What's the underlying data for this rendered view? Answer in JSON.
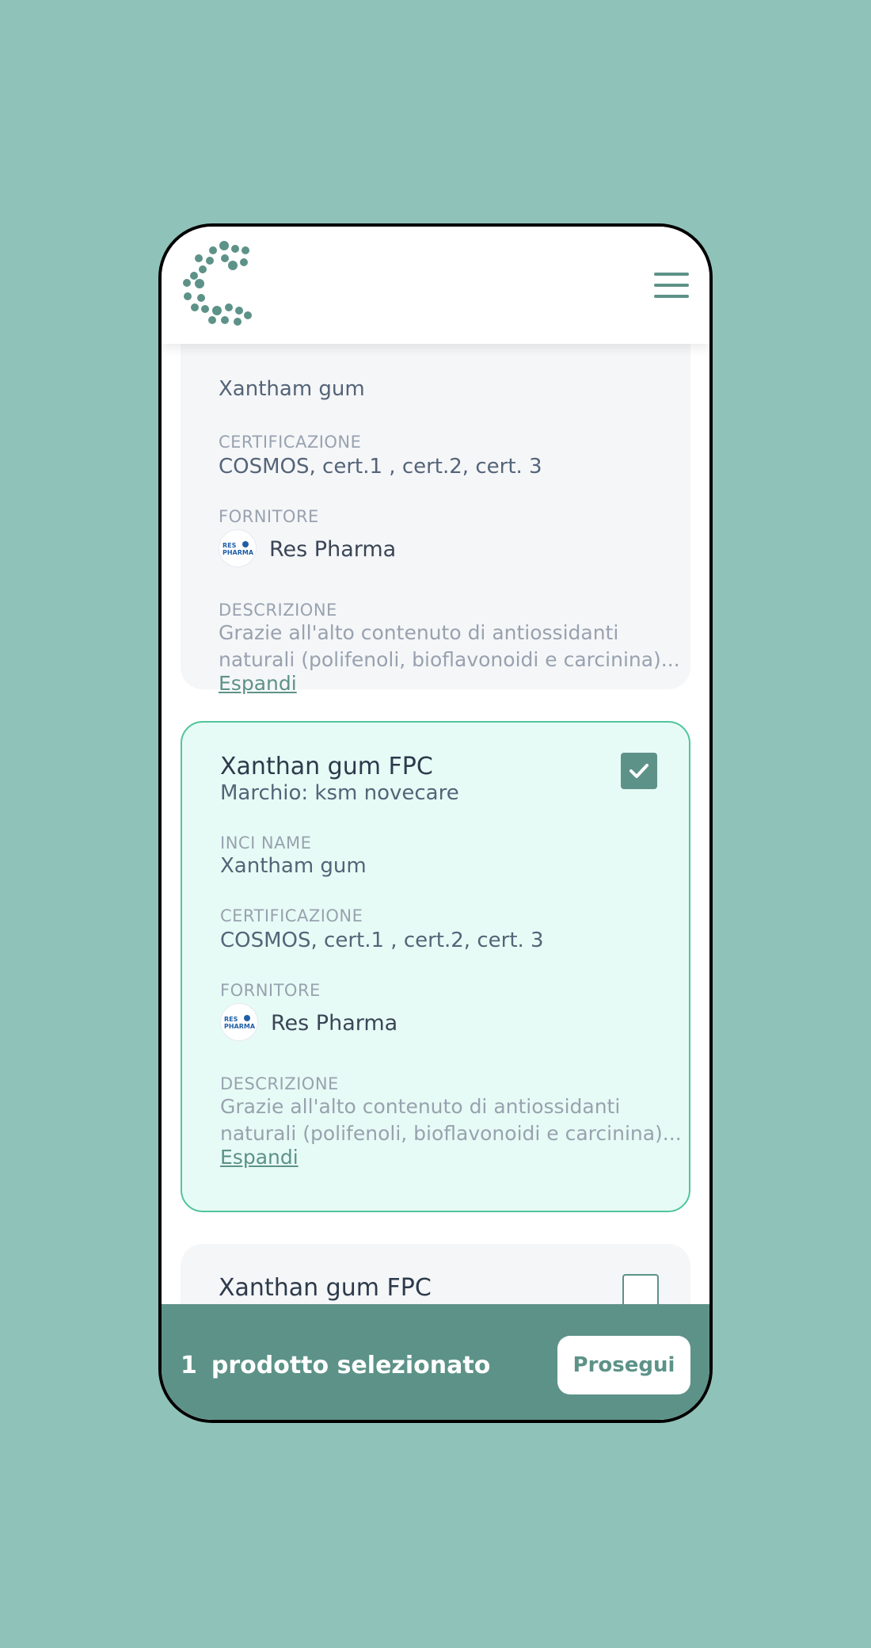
{
  "colors": {
    "background": "#8fc3ba",
    "accent": "#5d9288",
    "selected_border": "#4fc59b",
    "selected_bg": "#e7fbf6"
  },
  "header": {
    "logo": "C-dots-logo",
    "menu_icon": "hamburger-menu-icon"
  },
  "cards": [
    {
      "title": "",
      "inci_value": "Xantham gum",
      "cert_label": "CERTIFICAZIONE",
      "cert_value": "COSMOS, cert.1 , cert.2, cert. 3",
      "supplier_label": "FORNITORE",
      "supplier_name": "Res Pharma",
      "supplier_logo_text": "RES PHARMA",
      "desc_label": "DESCRIZIONE",
      "desc_line1": "Grazie all'alto contenuto di antiossidanti",
      "desc_line2": "naturali (polifenoli, bioflavonoidi e carcinina)...",
      "expand": "Espandi",
      "selected": false
    },
    {
      "title": "Xanthan gum FPC",
      "brand": "Marchio: ksm novecare",
      "inci_label": "INCI NAME",
      "inci_value": "Xantham gum",
      "cert_label": "CERTIFICAZIONE",
      "cert_value": "COSMOS, cert.1 , cert.2, cert. 3",
      "supplier_label": "FORNITORE",
      "supplier_name": "Res Pharma",
      "supplier_logo_text": "RES PHARMA",
      "desc_label": "DESCRIZIONE",
      "desc_line1": "Grazie all'alto contenuto di antiossidanti",
      "desc_line2": "naturali (polifenoli, bioflavonoidi e carcinina)...",
      "expand": "Espandi",
      "selected": true
    },
    {
      "title": "Xanthan gum FPC",
      "selected": false
    }
  ],
  "footer": {
    "count": "1",
    "count_label": "prodotto selezionato",
    "proceed_label": "Prosegui"
  }
}
